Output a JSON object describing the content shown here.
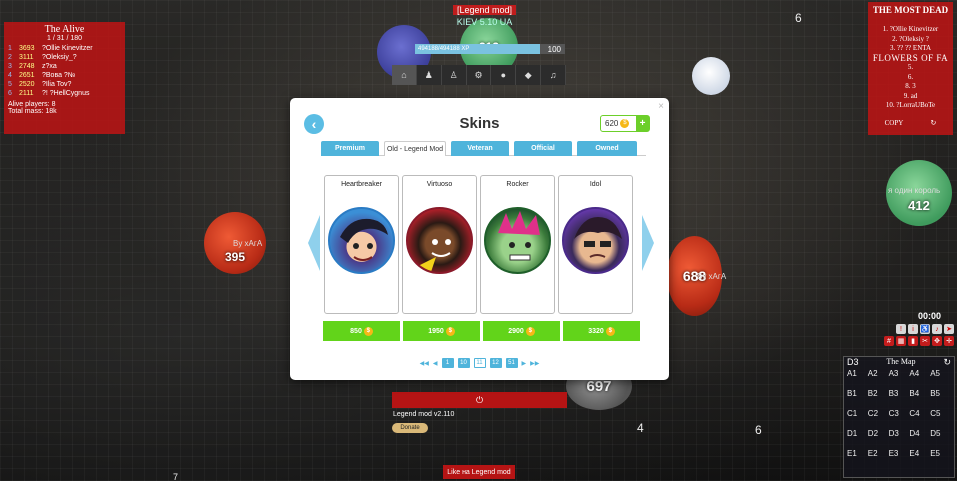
{
  "game": {
    "left_board": {
      "title": "The Alive",
      "subtitle": "1 / 31 / 180",
      "rows": [
        {
          "rank": "1",
          "score": "3693",
          "name": "?Ollie Kinevitzer"
        },
        {
          "rank": "2",
          "score": "3111",
          "name": "?Oleksiy_?"
        },
        {
          "rank": "3",
          "score": "2748",
          "name": "z?xa"
        },
        {
          "rank": "4",
          "score": "2651",
          "name": "?Вова ?№"
        },
        {
          "rank": "5",
          "score": "2520",
          "name": "?Ilia Tov?"
        },
        {
          "rank": "6",
          "score": "2111",
          "name": "?! ?HellCygnus"
        }
      ],
      "footer1": "Alive players: 8",
      "footer2": "Total mass: 18k"
    },
    "right_board": {
      "title": "THE MOST DEAD",
      "rows": [
        "1. ?Ollie Kinevitzer",
        "2. ?Oleksiy ?",
        "3. ?? ?? ENTA",
        "FLOWERS OF FA",
        "5.",
        "6.",
        "8. 3",
        "9. ad",
        "10. ?LorraUBoTe"
      ],
      "copy": "COPY",
      "refresh": "↻"
    },
    "top_hud": {
      "name": "[Legend mod]",
      "server": "KIEV 5.10 UA",
      "xp_text": "494188/494188 XP",
      "level": "100",
      "xp_progress": 0.83,
      "menu": [
        "⌂",
        "♟",
        "♙",
        "⚙",
        "●",
        "◆",
        "♫"
      ]
    },
    "cells": [
      {
        "label": "313",
        "name": "cell-313"
      },
      {
        "label": "395",
        "name": "cell-395"
      },
      {
        "label": "688",
        "name": "cell-688"
      },
      {
        "label": "412",
        "name": "cell-412"
      },
      {
        "label": "697",
        "name": "cell-697"
      },
      {
        "label": "я один король",
        "name": "cell-412-name"
      },
      {
        "label": "By хАгА",
        "name": "cell-395-by"
      },
      {
        "label": "By хАгА",
        "name": "cell-688-by"
      }
    ],
    "floating": [
      "6",
      "4",
      "6",
      "7"
    ],
    "bottom": {
      "play": "⏻",
      "version": "Legend mod v2.110",
      "donate": "Donate",
      "red_bar": "Like на Legend mod"
    },
    "timer": "00:00",
    "minimap": {
      "zone": "D3",
      "title": "The Map",
      "refresh": "↻",
      "cells": [
        "A1",
        "A2",
        "A3",
        "A4",
        "A5",
        "B1",
        "B2",
        "B3",
        "B4",
        "B5",
        "C1",
        "C2",
        "C3",
        "C4",
        "C5",
        "D1",
        "D2",
        "D3",
        "D4",
        "D5",
        "E1",
        "E2",
        "E3",
        "E4",
        "E5"
      ]
    }
  },
  "skins_modal": {
    "title": "Skins",
    "coins": "620",
    "coin_glyph": "$",
    "plus": "+",
    "back": "‹",
    "close": "×",
    "tabs": [
      "Premium",
      "Old - Legend Mod",
      "Veteran",
      "Official",
      "Owned"
    ],
    "active_tab": 1,
    "skins": [
      {
        "name": "Heartbreaker",
        "price": "850"
      },
      {
        "name": "Virtuoso",
        "price": "1950"
      },
      {
        "name": "Rocker",
        "price": "2900"
      },
      {
        "name": "Idol",
        "price": "3320"
      }
    ],
    "pager": {
      "first": "◀◀",
      "prev": "◀",
      "pages": [
        "1",
        "10",
        "11",
        "12",
        "51"
      ],
      "current": "11",
      "next": "▶",
      "last": "▶▶"
    },
    "colors": {
      "accent": "#4fb4db",
      "buy": "#62d41a",
      "coin": "#f6b817"
    }
  }
}
